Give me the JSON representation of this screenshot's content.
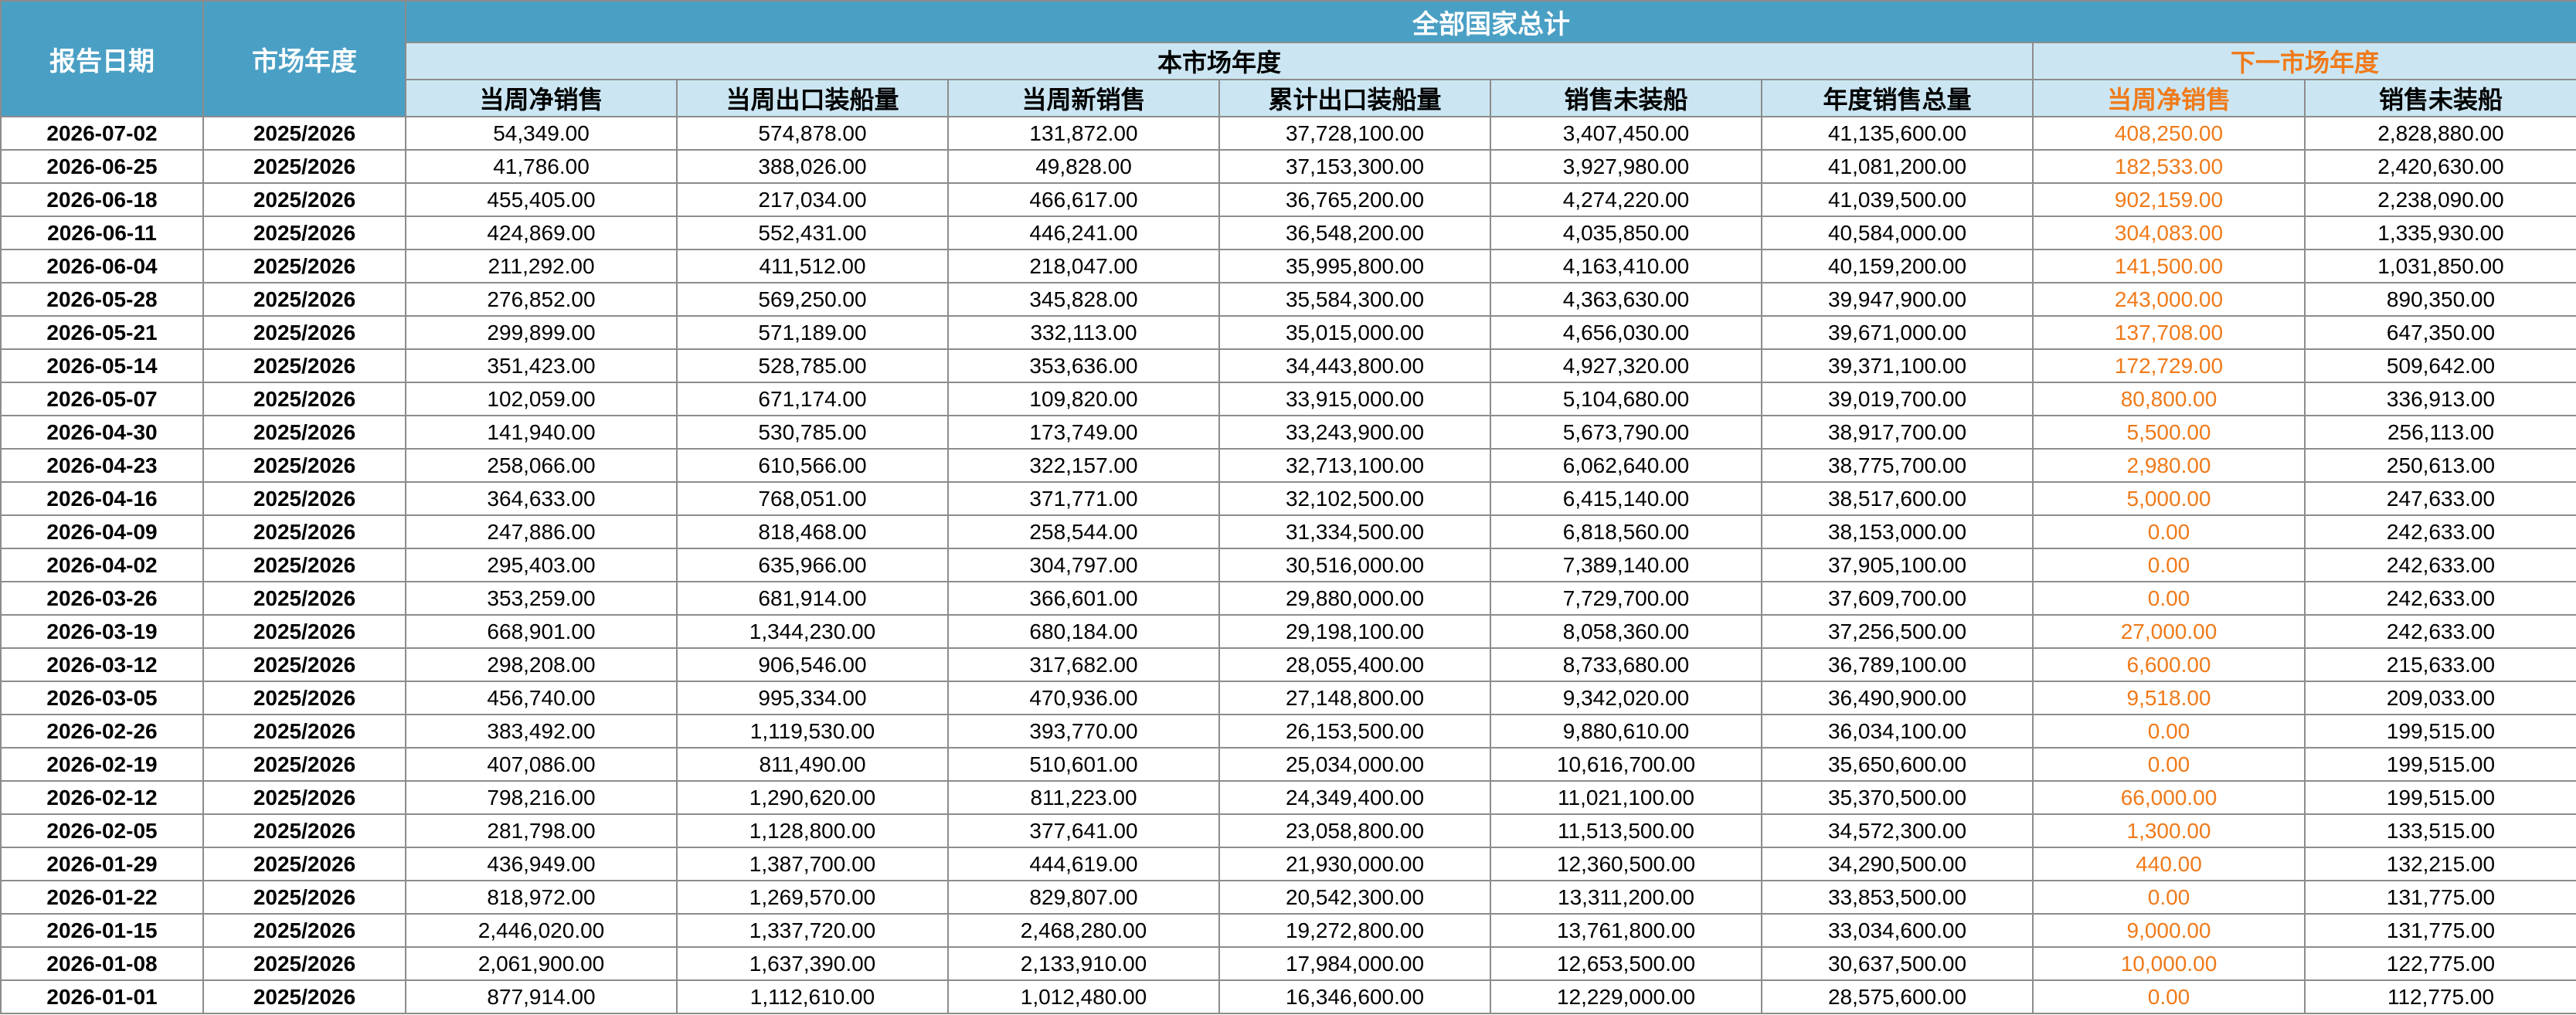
{
  "header": {
    "report_date": "报告日期",
    "market_year": "市场年度",
    "all_countries": "全部国家总计",
    "this_year": "本市场年度",
    "next_year": "下一市场年度"
  },
  "columns": [
    "当周净销售",
    "当周出口装船量",
    "当周新销售",
    "累计出口装船量",
    "销售未装船",
    "年度销售总量",
    "当周净销售",
    "销售未装船"
  ],
  "rows": [
    [
      "2026-07-02",
      "2025/2026",
      "54,349.00",
      "574,878.00",
      "131,872.00",
      "37,728,100.00",
      "3,407,450.00",
      "41,135,600.00",
      "408,250.00",
      "2,828,880.00"
    ],
    [
      "2026-06-25",
      "2025/2026",
      "41,786.00",
      "388,026.00",
      "49,828.00",
      "37,153,300.00",
      "3,927,980.00",
      "41,081,200.00",
      "182,533.00",
      "2,420,630.00"
    ],
    [
      "2026-06-18",
      "2025/2026",
      "455,405.00",
      "217,034.00",
      "466,617.00",
      "36,765,200.00",
      "4,274,220.00",
      "41,039,500.00",
      "902,159.00",
      "2,238,090.00"
    ],
    [
      "2026-06-11",
      "2025/2026",
      "424,869.00",
      "552,431.00",
      "446,241.00",
      "36,548,200.00",
      "4,035,850.00",
      "40,584,000.00",
      "304,083.00",
      "1,335,930.00"
    ],
    [
      "2026-06-04",
      "2025/2026",
      "211,292.00",
      "411,512.00",
      "218,047.00",
      "35,995,800.00",
      "4,163,410.00",
      "40,159,200.00",
      "141,500.00",
      "1,031,850.00"
    ],
    [
      "2026-05-28",
      "2025/2026",
      "276,852.00",
      "569,250.00",
      "345,828.00",
      "35,584,300.00",
      "4,363,630.00",
      "39,947,900.00",
      "243,000.00",
      "890,350.00"
    ],
    [
      "2026-05-21",
      "2025/2026",
      "299,899.00",
      "571,189.00",
      "332,113.00",
      "35,015,000.00",
      "4,656,030.00",
      "39,671,000.00",
      "137,708.00",
      "647,350.00"
    ],
    [
      "2026-05-14",
      "2025/2026",
      "351,423.00",
      "528,785.00",
      "353,636.00",
      "34,443,800.00",
      "4,927,320.00",
      "39,371,100.00",
      "172,729.00",
      "509,642.00"
    ],
    [
      "2026-05-07",
      "2025/2026",
      "102,059.00",
      "671,174.00",
      "109,820.00",
      "33,915,000.00",
      "5,104,680.00",
      "39,019,700.00",
      "80,800.00",
      "336,913.00"
    ],
    [
      "2026-04-30",
      "2025/2026",
      "141,940.00",
      "530,785.00",
      "173,749.00",
      "33,243,900.00",
      "5,673,790.00",
      "38,917,700.00",
      "5,500.00",
      "256,113.00"
    ],
    [
      "2026-04-23",
      "2025/2026",
      "258,066.00",
      "610,566.00",
      "322,157.00",
      "32,713,100.00",
      "6,062,640.00",
      "38,775,700.00",
      "2,980.00",
      "250,613.00"
    ],
    [
      "2026-04-16",
      "2025/2026",
      "364,633.00",
      "768,051.00",
      "371,771.00",
      "32,102,500.00",
      "6,415,140.00",
      "38,517,600.00",
      "5,000.00",
      "247,633.00"
    ],
    [
      "2026-04-09",
      "2025/2026",
      "247,886.00",
      "818,468.00",
      "258,544.00",
      "31,334,500.00",
      "6,818,560.00",
      "38,153,000.00",
      "0.00",
      "242,633.00"
    ],
    [
      "2026-04-02",
      "2025/2026",
      "295,403.00",
      "635,966.00",
      "304,797.00",
      "30,516,000.00",
      "7,389,140.00",
      "37,905,100.00",
      "0.00",
      "242,633.00"
    ],
    [
      "2026-03-26",
      "2025/2026",
      "353,259.00",
      "681,914.00",
      "366,601.00",
      "29,880,000.00",
      "7,729,700.00",
      "37,609,700.00",
      "0.00",
      "242,633.00"
    ],
    [
      "2026-03-19",
      "2025/2026",
      "668,901.00",
      "1,344,230.00",
      "680,184.00",
      "29,198,100.00",
      "8,058,360.00",
      "37,256,500.00",
      "27,000.00",
      "242,633.00"
    ],
    [
      "2026-03-12",
      "2025/2026",
      "298,208.00",
      "906,546.00",
      "317,682.00",
      "28,055,400.00",
      "8,733,680.00",
      "36,789,100.00",
      "6,600.00",
      "215,633.00"
    ],
    [
      "2026-03-05",
      "2025/2026",
      "456,740.00",
      "995,334.00",
      "470,936.00",
      "27,148,800.00",
      "9,342,020.00",
      "36,490,900.00",
      "9,518.00",
      "209,033.00"
    ],
    [
      "2026-02-26",
      "2025/2026",
      "383,492.00",
      "1,119,530.00",
      "393,770.00",
      "26,153,500.00",
      "9,880,610.00",
      "36,034,100.00",
      "0.00",
      "199,515.00"
    ],
    [
      "2026-02-19",
      "2025/2026",
      "407,086.00",
      "811,490.00",
      "510,601.00",
      "25,034,000.00",
      "10,616,700.00",
      "35,650,600.00",
      "0.00",
      "199,515.00"
    ],
    [
      "2026-02-12",
      "2025/2026",
      "798,216.00",
      "1,290,620.00",
      "811,223.00",
      "24,349,400.00",
      "11,021,100.00",
      "35,370,500.00",
      "66,000.00",
      "199,515.00"
    ],
    [
      "2026-02-05",
      "2025/2026",
      "281,798.00",
      "1,128,800.00",
      "377,641.00",
      "23,058,800.00",
      "11,513,500.00",
      "34,572,300.00",
      "1,300.00",
      "133,515.00"
    ],
    [
      "2026-01-29",
      "2025/2026",
      "436,949.00",
      "1,387,700.00",
      "444,619.00",
      "21,930,000.00",
      "12,360,500.00",
      "34,290,500.00",
      "440.00",
      "132,215.00"
    ],
    [
      "2026-01-22",
      "2025/2026",
      "818,972.00",
      "1,269,570.00",
      "829,807.00",
      "20,542,300.00",
      "13,311,200.00",
      "33,853,500.00",
      "0.00",
      "131,775.00"
    ],
    [
      "2026-01-15",
      "2025/2026",
      "2,446,020.00",
      "1,337,720.00",
      "2,468,280.00",
      "19,272,800.00",
      "13,761,800.00",
      "33,034,600.00",
      "9,000.00",
      "131,775.00"
    ],
    [
      "2026-01-08",
      "2025/2026",
      "2,061,900.00",
      "1,637,390.00",
      "2,133,910.00",
      "17,984,000.00",
      "12,653,500.00",
      "30,637,500.00",
      "10,000.00",
      "122,775.00"
    ],
    [
      "2026-01-01",
      "2025/2026",
      "877,914.00",
      "1,112,610.00",
      "1,012,480.00",
      "16,346,600.00",
      "12,229,000.00",
      "28,575,600.00",
      "0.00",
      "112,775.00"
    ]
  ],
  "colors": {
    "header_dark": "#4a9fc4",
    "header_light": "#cbe6f2",
    "next_year_accent": "#f07a1a"
  }
}
